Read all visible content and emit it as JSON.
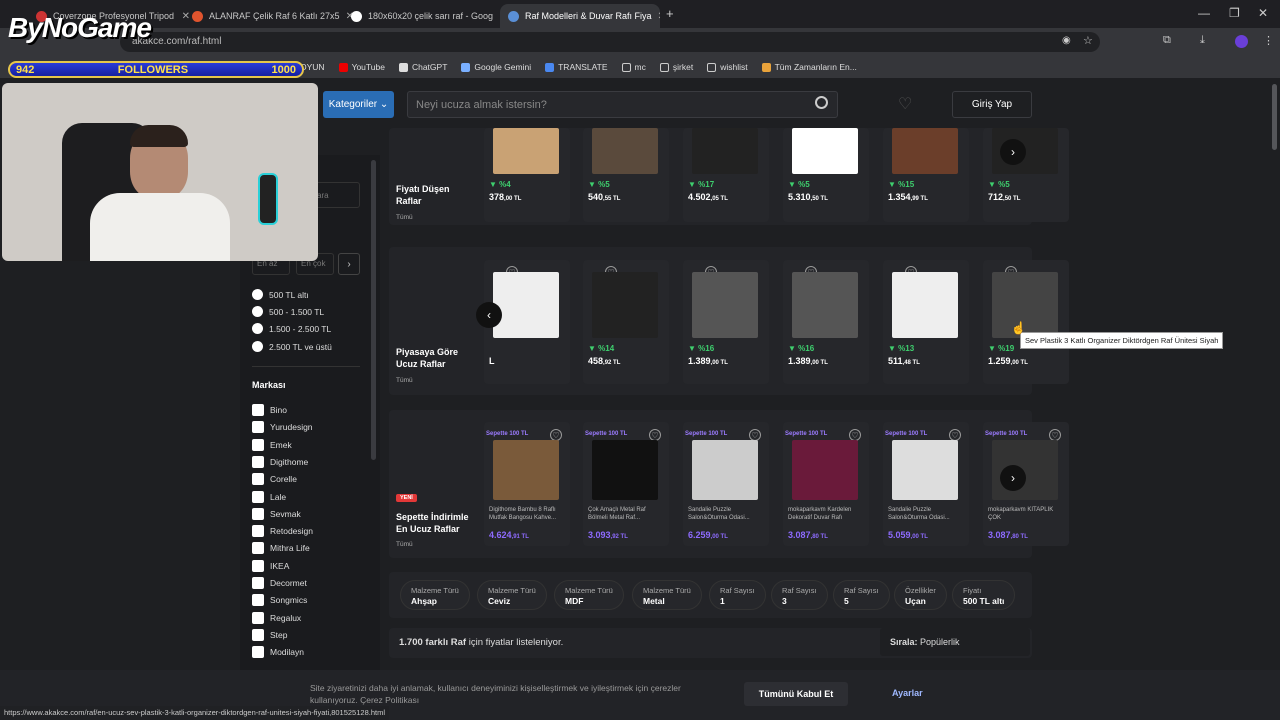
{
  "tabs": [
    {
      "label": "Coverzone Profesyonel Tripod"
    },
    {
      "label": "ALANRAF Çelik Raf 6 Katlı 27x5"
    },
    {
      "label": "180x60x20 çelik sarı raf - Goog"
    },
    {
      "label": "Raf Modelleri & Duvar Rafı Fiya"
    }
  ],
  "url": "akakce.com/raf.html",
  "bookmarks": [
    "OYUN",
    "YouTube",
    "ChatGPT",
    "Google Gemini",
    "TRANSLATE",
    "mc",
    "şirket",
    "wishlist",
    "Tüm Zamanların En..."
  ],
  "overlay": {
    "logo": "ByNoGame",
    "followers_current": "942",
    "followers_label": "FOLLOWERS",
    "followers_goal": "1000"
  },
  "header": {
    "kategoriler": "Kategoriler",
    "search_placeholder": "Neyi ucuza almak istersin?",
    "login": "Giriş Yap"
  },
  "sidebar": {
    "search_placeholder": "ara",
    "price_min_placeholder": "En az",
    "price_max_placeholder": "En çok",
    "price_ranges": [
      "500 TL altı",
      "500 - 1.500 TL",
      "1.500 - 2.500 TL",
      "2.500 TL ve üstü"
    ],
    "brand_title": "Markası",
    "brands": [
      "Bino",
      "Yurudesign",
      "Emek",
      "Digithome",
      "Corelle",
      "Lale",
      "Sevmak",
      "Retodesign",
      "Mithra Life",
      "IKEA",
      "Decormet",
      "Songmics",
      "Regalux",
      "Step",
      "Modilayn"
    ]
  },
  "sections": [
    {
      "title": "Fiyatı Düşen Raflar",
      "link": "Tümü",
      "products": [
        {
          "disc": "%4",
          "price": "378",
          "cents": ",00 TL"
        },
        {
          "disc": "%5",
          "price": "540",
          "cents": ",55 TL"
        },
        {
          "disc": "%17",
          "price": "4.502",
          "cents": ",05 TL"
        },
        {
          "disc": "%5",
          "price": "5.310",
          "cents": ",50 TL"
        },
        {
          "disc": "%15",
          "price": "1.354",
          "cents": ",99 TL"
        },
        {
          "disc": "%5",
          "price": "712",
          "cents": ",50 TL"
        }
      ]
    },
    {
      "title": "Piyasaya Göre Ucuz Raflar",
      "link": "Tümü",
      "products": [
        {
          "disc": "",
          "price": "L",
          "cents": ""
        },
        {
          "disc": "%14",
          "price": "458",
          "cents": ",92 TL"
        },
        {
          "disc": "%16",
          "price": "1.389",
          "cents": ",00 TL"
        },
        {
          "disc": "%16",
          "price": "1.389",
          "cents": ",00 TL"
        },
        {
          "disc": "%13",
          "price": "511",
          "cents": ",48 TL"
        },
        {
          "disc": "%19",
          "price": "1.259",
          "cents": ",00 TL"
        }
      ]
    },
    {
      "title": "Sepette İndirimle En Ucuz Raflar",
      "badge": "YENİ",
      "link": "Tümü",
      "products": [
        {
          "promo": "Sepette 100 TL",
          "desc": "Digithome Bambu 8 Raflı Mutfak Bangosu Kahve...",
          "price": "4.624",
          "cents": ",91 TL"
        },
        {
          "promo": "Sepette 100 TL",
          "desc": "Çok Amaçlı Metal Raf Bölmeli Metal Raf...",
          "price": "3.093",
          "cents": ",92 TL"
        },
        {
          "promo": "Sepette 100 TL",
          "desc": "Sandalie Puzzle Salon&Oturma Odasi...",
          "price": "6.259",
          "cents": ",00 TL"
        },
        {
          "promo": "Sepette 100 TL",
          "desc": "mokaparkavm Kardelen Dekoratif Duvar Rafı",
          "price": "3.087",
          "cents": ",80 TL"
        },
        {
          "promo": "Sepette 100 TL",
          "desc": "Sandalie Puzzle Salon&Oturma Odasi...",
          "price": "5.059",
          "cents": ",00 TL"
        },
        {
          "promo": "Sepette 100 TL",
          "desc": "mokaparkavm KİTAPLIK ÇOK",
          "price": "3.087",
          "cents": ",80 TL"
        }
      ]
    }
  ],
  "tooltip": "Sev Plastik 3 Katlı Organizer Diktördgen Raf Ünitesi Siyah",
  "chips": [
    {
      "label": "Malzeme Türü",
      "value": "Ahşap"
    },
    {
      "label": "Malzeme Türü",
      "value": "Ceviz"
    },
    {
      "label": "Malzeme Türü",
      "value": "MDF"
    },
    {
      "label": "Malzeme Türü",
      "value": "Metal"
    },
    {
      "label": "Raf Sayısı",
      "value": "1"
    },
    {
      "label": "Raf Sayısı",
      "value": "3"
    },
    {
      "label": "Raf Sayısı",
      "value": "5"
    },
    {
      "label": "Özellikler",
      "value": "Uçan"
    },
    {
      "label": "Fiyatı",
      "value": "500 TL altı"
    }
  ],
  "listing": {
    "count": "1.700 farklı Raf",
    "suffix": "için fiyatlar listeleniyor.",
    "sort_label": "Sırala:",
    "sort_value": "Popülerlik"
  },
  "cookie": {
    "text": "Site ziyaretinizi daha iyi anlamak, kullanıcı deneyiminizi kişiselleştirmek ve iyileştirmek için çerezler kullanıyoruz.",
    "policy": "Çerez Politikası",
    "accept": "Tümünü Kabul Et",
    "settings": "Ayarlar"
  },
  "status_url": "https://www.akakce.com/raf/en-ucuz-sev-plastik-3-katli-organizer-diktordgen-raf-unitesi-siyah-fiyati,801525128.html"
}
